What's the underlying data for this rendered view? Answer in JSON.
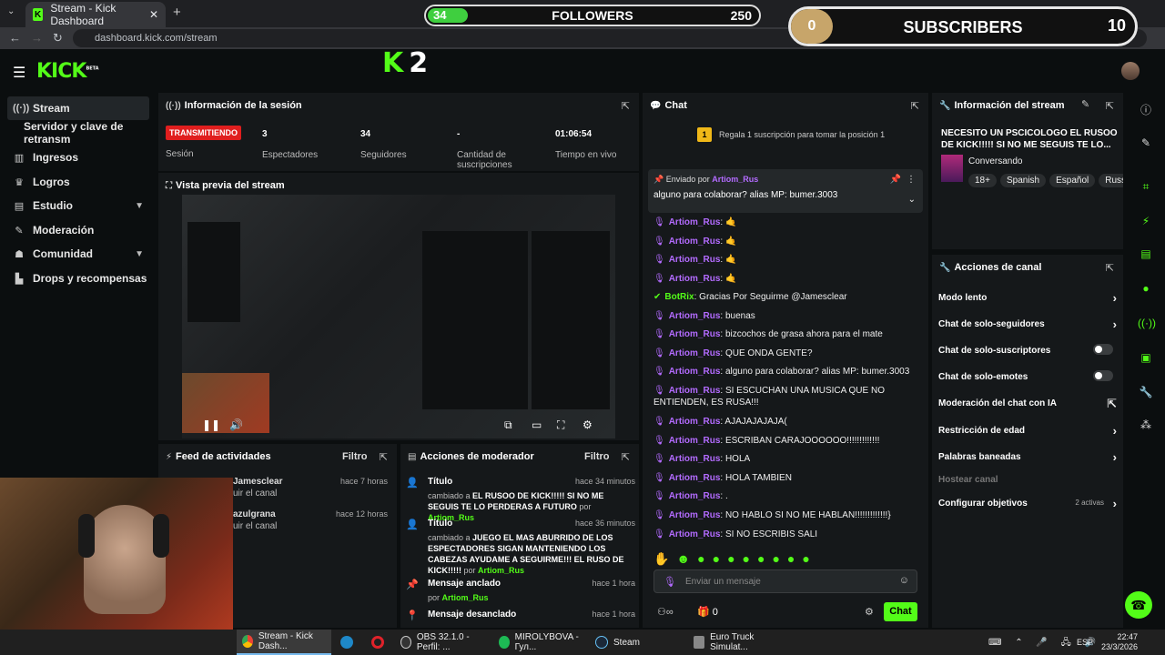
{
  "browser": {
    "tab_title": "Stream - Kick Dashboard",
    "url": "dashboard.kick.com/stream",
    "tab_close": "✕",
    "new_tab": "+"
  },
  "overlays": {
    "followers": {
      "current": "34",
      "label": "FOLLOWERS",
      "goal": "250",
      "progress_fraction": 0.136
    },
    "subscribers": {
      "current": "0",
      "label": "SUBSCRIBERS",
      "goal": "10",
      "progress_fraction": 0.0
    }
  },
  "header": {
    "logo": "KICK",
    "logo_sup": "BETA",
    "k2_logo": "K",
    "k2_num": "2"
  },
  "sidebar": {
    "items": [
      {
        "label": "Stream",
        "icon": "stream-icon"
      },
      {
        "label": "Servidor y clave de retransm"
      },
      {
        "label": "Ingresos",
        "icon": "income-icon"
      },
      {
        "label": "Logros",
        "icon": "trophy-icon"
      },
      {
        "label": "Estudio",
        "icon": "studio-icon"
      },
      {
        "label": "Moderación",
        "icon": "moderation-icon"
      },
      {
        "label": "Comunidad",
        "icon": "community-icon"
      },
      {
        "label": "Drops y recompensas",
        "icon": "drops-icon"
      }
    ]
  },
  "session": {
    "title": "Información de la sesión",
    "status": "TRANSMITIENDO",
    "status_label": "Sesión",
    "viewers": "3",
    "viewers_label": "Espectadores",
    "followers": "34",
    "followers_label": "Seguidores",
    "subs": "-",
    "subs_label": "Cantidad de suscripciones",
    "time": "01:06:54",
    "time_label": "Tiempo en vivo"
  },
  "preview": {
    "title": "Vista previa del stream"
  },
  "feed": {
    "title": "Feed de actividades",
    "filter": "Filtro",
    "items": [
      {
        "user": "Jamesclear",
        "action": "uir el canal",
        "time": "hace 7 horas"
      },
      {
        "user": "azulgrana",
        "action": "uir el canal",
        "time": "hace 12 horas"
      }
    ]
  },
  "modactions": {
    "title": "Acciones de moderador",
    "filter": "Filtro",
    "items": [
      {
        "type": "Título",
        "time": "hace 34 minutos",
        "prefix": "cambiado a",
        "value": "EL RUSOO DE KICK!!!!! SI NO ME SEGUIS TE LO PERDERAS A FUTURO",
        "by": "por",
        "user": "Artiom_Rus"
      },
      {
        "type": "Título",
        "time": "hace 36 minutos",
        "prefix": "cambiado a",
        "value": "JUEGO EL MAS ABURRIDO DE LOS ESPECTADORES SIGAN MANTENIENDO LOS CABEZAS AYUDAME A SEGUIRME!!! EL RUSO DE KICK!!!!!",
        "by": "por",
        "user": "Artiom_Rus"
      },
      {
        "type": "Mensaje anclado",
        "time": "hace 1 hora",
        "by": "por",
        "user": "Artiom_Rus"
      },
      {
        "type": "Mensaje desanclado",
        "time": "hace 1 hora"
      }
    ]
  },
  "chat": {
    "title": "Chat",
    "gift_text": "Regala 1 suscripción para tomar la posición 1",
    "gift_num": "1",
    "pinned_by_label": "Enviado por",
    "pinned_user": "Artiom_Rus",
    "pinned_msg": "alguno para colaborar? alias MP: bumer.3003",
    "messages": [
      {
        "user": "Artiom_Rus",
        "text": ": 🤙"
      },
      {
        "user": "Artiom_Rus",
        "text": ": 🤙"
      },
      {
        "user": "Artiom_Rus",
        "text": ": 🤙"
      },
      {
        "user": "Artiom_Rus",
        "text": ": 🤙"
      },
      {
        "user": "BotRix",
        "text": ": Gracias Por Seguirme @Jamesclear",
        "bot": true
      },
      {
        "user": "Artiom_Rus",
        "text": ": buenas"
      },
      {
        "user": "Artiom_Rus",
        "text": ": bizcochos de grasa ahora para el mate"
      },
      {
        "user": "Artiom_Rus",
        "text": ": QUE ONDA GENTE?"
      },
      {
        "user": "Artiom_Rus",
        "text": ": alguno para colaborar? alias MP: bumer.3003"
      },
      {
        "user": "Artiom_Rus",
        "text": ": SI ESCUCHAN UNA MUSICA QUE NO ENTIENDEN, ES RUSA!!!"
      },
      {
        "user": "Artiom_Rus",
        "text": ": AJAJAJAJAJA("
      },
      {
        "user": "Artiom_Rus",
        "text": ": ESCRIBAN CARAJOOOOOO!!!!!!!!!!!!!"
      },
      {
        "user": "Artiom_Rus",
        "text": ": HOLA"
      },
      {
        "user": "Artiom_Rus",
        "text": ": HOLA TAMBIEN"
      },
      {
        "user": "Artiom_Rus",
        "text": ": ."
      },
      {
        "user": "Artiom_Rus",
        "text": ": NO HABLO SI NO ME HABLAN!!!!!!!!!!!!!}"
      },
      {
        "user": "Artiom_Rus",
        "text": ": SI NO ESCRIBIS SALI"
      }
    ],
    "input_placeholder": "Enviar un mensaje",
    "points": "0",
    "send_label": "Chat"
  },
  "stream_info": {
    "title": "Información del stream",
    "stream_title": "NECESITO UN PSCICOLOGO EL RUSOO DE KICK!!!!! SI NO ME SEGUIS TE LO...",
    "category": "Conversando",
    "tags": [
      "18+",
      "Spanish",
      "Español",
      "Russ"
    ]
  },
  "channel_actions": {
    "title": "Acciones de canal",
    "items": [
      {
        "label": "Modo lento",
        "control": "arrow"
      },
      {
        "label": "Chat de solo-seguidores",
        "control": "arrow"
      },
      {
        "label": "Chat de solo-suscriptores",
        "control": "toggle"
      },
      {
        "label": "Chat de solo-emotes",
        "control": "toggle"
      },
      {
        "label": "Moderación del chat con IA",
        "control": "external"
      },
      {
        "label": "Restricción de edad",
        "control": "arrow"
      },
      {
        "label": "Palabras baneadas",
        "control": "arrow"
      },
      {
        "label": "Hostear canal",
        "control": "none"
      },
      {
        "label": "Configurar objetivos",
        "control": "arrow",
        "extra": "2 activas"
      }
    ]
  },
  "taskbar": {
    "items": [
      {
        "label": "Stream - Kick Dash..."
      },
      {
        "label": "OBS 32.1.0 - Perfil: ..."
      },
      {
        "label": "MIROLYBOVA - Гул..."
      },
      {
        "label": "Steam"
      },
      {
        "label": "Euro Truck Simulat..."
      }
    ],
    "lang": "ESP",
    "time": "22:47",
    "date": "23/3/2026"
  }
}
